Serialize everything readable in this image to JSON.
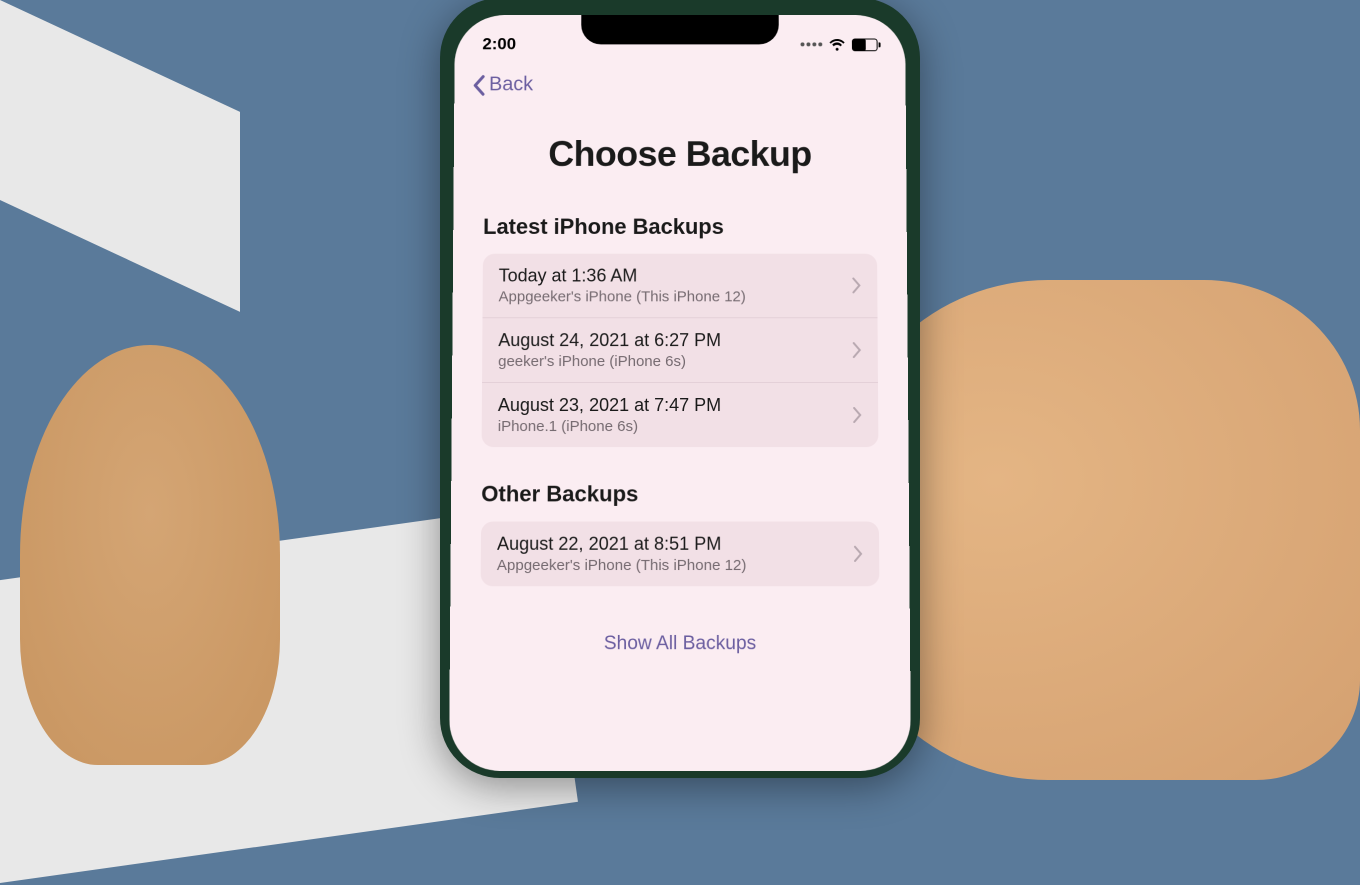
{
  "status": {
    "time": "2:00"
  },
  "nav": {
    "back_label": "Back"
  },
  "page": {
    "title": "Choose Backup"
  },
  "sections": {
    "latest": {
      "header": "Latest iPhone Backups",
      "items": [
        {
          "title": "Today at 1:36 AM",
          "subtitle": "Appgeeker's iPhone (This iPhone 12)"
        },
        {
          "title": "August 24, 2021 at 6:27 PM",
          "subtitle": "geeker's iPhone (iPhone 6s)"
        },
        {
          "title": "August 23, 2021 at 7:47 PM",
          "subtitle": "iPhone.1 (iPhone 6s)"
        }
      ]
    },
    "other": {
      "header": "Other Backups",
      "items": [
        {
          "title": "August 22, 2021 at 8:51 PM",
          "subtitle": "Appgeeker's iPhone (This iPhone 12)"
        }
      ]
    }
  },
  "footer": {
    "show_all_label": "Show All Backups"
  }
}
